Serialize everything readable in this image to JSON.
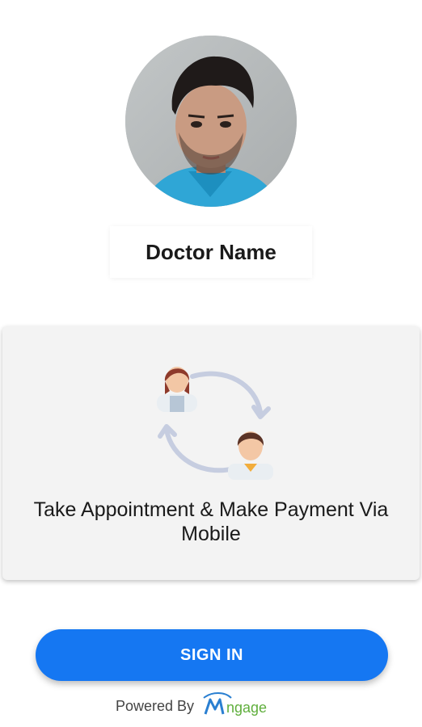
{
  "profile": {
    "doctor_name": "Doctor Name"
  },
  "feature": {
    "text": "Take Appointment & Make Payment Via Mobile",
    "illustration_icon": "appointment-exchange-icon"
  },
  "actions": {
    "signin_label": "SIGN IN"
  },
  "footer": {
    "powered_by": "Powered By",
    "brand_logo_text": "MEngage"
  },
  "colors": {
    "primary": "#1577f2",
    "card_background": "#f3f3f3",
    "arrow": "#c6cde0",
    "logo_blue": "#2a7fd1",
    "logo_green": "#5fae3c"
  }
}
